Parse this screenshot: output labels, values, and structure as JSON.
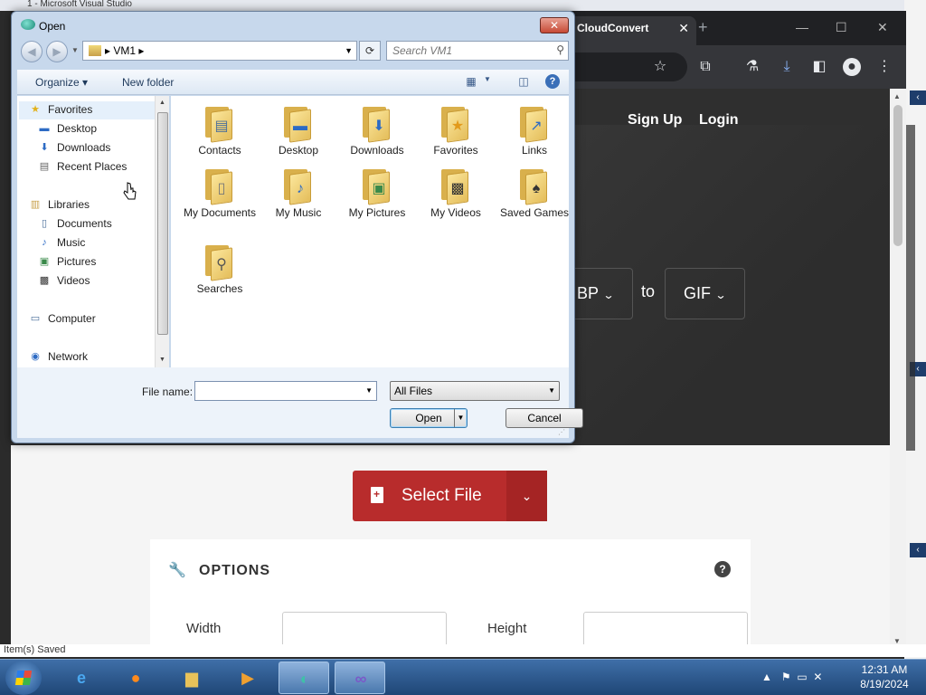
{
  "background": {
    "vs_title": "1 - Microsoft Visual Studio",
    "status_text": "Item(s) Saved"
  },
  "browser": {
    "tab_title": "CloudConvert",
    "nav": {
      "signup": "Sign Up",
      "login": "Login"
    },
    "convert": {
      "from": "BP",
      "to_word": "to",
      "to": "GIF"
    },
    "select_file": "Select File",
    "options": {
      "heading": "OPTIONS",
      "width_label": "Width",
      "height_label": "Height"
    }
  },
  "dialog": {
    "title": "Open",
    "address": "VM1",
    "search_placeholder": "Search VM1",
    "toolbar": {
      "organize": "Organize",
      "new_folder": "New folder"
    },
    "nav": {
      "favorites": "Favorites",
      "desktop": "Desktop",
      "downloads": "Downloads",
      "recent_places": "Recent Places",
      "libraries": "Libraries",
      "documents": "Documents",
      "music": "Music",
      "pictures": "Pictures",
      "videos": "Videos",
      "computer": "Computer",
      "network": "Network"
    },
    "files": [
      {
        "label": "Contacts",
        "icon": "contacts-icon"
      },
      {
        "label": "Desktop",
        "icon": "desktop-icon"
      },
      {
        "label": "Downloads",
        "icon": "downloads-icon"
      },
      {
        "label": "Favorites",
        "icon": "favorites-icon"
      },
      {
        "label": "Links",
        "icon": "links-icon"
      },
      {
        "label": "My Documents",
        "icon": "documents-icon"
      },
      {
        "label": "My Music",
        "icon": "music-icon"
      },
      {
        "label": "My Pictures",
        "icon": "pictures-icon"
      },
      {
        "label": "My Videos",
        "icon": "videos-icon"
      },
      {
        "label": "Saved Games",
        "icon": "games-icon"
      },
      {
        "label": "Searches",
        "icon": "search-icon"
      }
    ],
    "file_name_label": "File name:",
    "file_name_value": "",
    "file_type": "All Files",
    "open_button": "Open",
    "cancel_button": "Cancel"
  },
  "taskbar": {
    "time": "12:31 AM",
    "date": "8/19/2024"
  }
}
